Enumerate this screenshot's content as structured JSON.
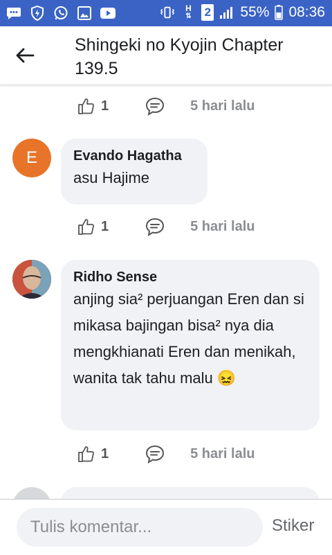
{
  "status_bar": {
    "battery_percent": "55%",
    "time": "08:36",
    "network_label": "H",
    "sim_label": "2",
    "left_icons": [
      "message-icon",
      "shield-icon",
      "whatsapp-icon",
      "gallery-icon",
      "youtube-icon"
    ],
    "right_icons": [
      "vibrate-icon",
      "network-icon",
      "signal-icon",
      "battery-icon"
    ]
  },
  "header": {
    "title": "Shingeki no Kyojin Chapter 139.5"
  },
  "comments": [
    {
      "likes": "1",
      "time": "5 hari lalu"
    },
    {
      "avatar_letter": "E",
      "author": "Evando Hagatha",
      "text": "asu Hajime",
      "likes": "1",
      "time": "5 hari lalu"
    },
    {
      "author": "Ridho Sense",
      "text": "anjing sia² perjuangan Eren dan si mikasa bajingan bisa² nya dia mengkhianati Eren dan menikah, wanita tak tahu malu",
      "emoji": "😖",
      "likes": "1",
      "time": "5 hari lalu"
    }
  ],
  "footer": {
    "input_placeholder": "Tulis komentar...",
    "sticker_label": "Stiker"
  },
  "colors": {
    "status_bar": "#3b63c6",
    "avatar_e": "#e8742a",
    "bubble": "#f0f2f5"
  }
}
